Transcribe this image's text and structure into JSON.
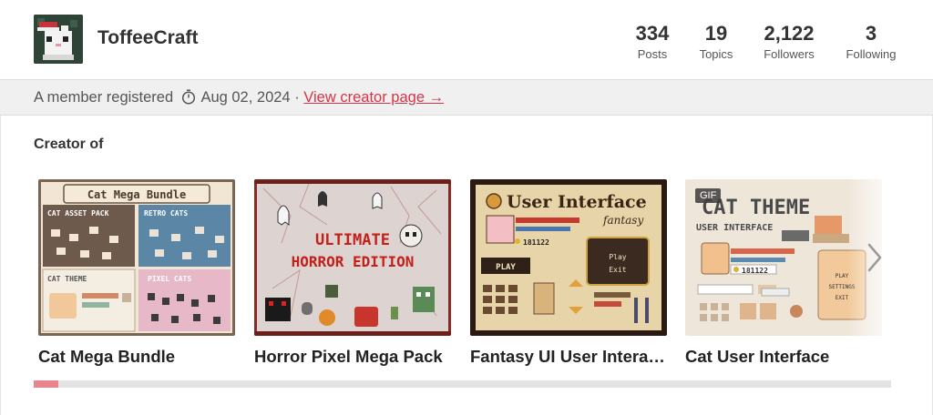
{
  "profile": {
    "username": "ToffeeCraft",
    "avatar_icon": "pixel-cat-santa-hat-avatar"
  },
  "stats": [
    {
      "value": "334",
      "label": "Posts"
    },
    {
      "value": "19",
      "label": "Topics"
    },
    {
      "value": "2,122",
      "label": "Followers"
    },
    {
      "value": "3",
      "label": "Following"
    }
  ],
  "info": {
    "registered_text": "A member registered",
    "date": "Aug 02, 2024",
    "separator": "·",
    "link_label": "View creator page →"
  },
  "section_title": "Creator of",
  "cards": [
    {
      "title": "Cat Mega Bundle",
      "thumb_heading": "Cat Mega Bundle",
      "thumb_blocks": [
        "CAT ASSET PACK",
        "RETRO CATS",
        "CAT THEME",
        "PIXEL CATS"
      ]
    },
    {
      "title": "Horror Pixel Mega Pack",
      "thumb_line1": "ULTIMATE",
      "thumb_line2": "HORROR EDITION"
    },
    {
      "title": "Fantasy UI User Interaf…",
      "thumb_heading": "User Interface",
      "thumb_sub": "fantasy",
      "thumb_play": "PLAY",
      "thumb_menu_play": "Play",
      "thumb_menu_exit": "Exit",
      "thumb_gold": "181122"
    },
    {
      "title": "Cat User Interface",
      "badge": "GIF",
      "thumb_heading": "CAT THEME",
      "thumb_sub": "USER INTERFACE",
      "thumb_gold": "181122",
      "thumb_btn1": "PLAY",
      "thumb_btn2": "SETTINGS",
      "thumb_btn3": "EXIT"
    }
  ],
  "carousel": {
    "next_icon": "chevron-right-icon",
    "scroll_position": 0.03
  },
  "colors": {
    "accent": "#d63447",
    "scroll_thumb": "#e8848d"
  }
}
